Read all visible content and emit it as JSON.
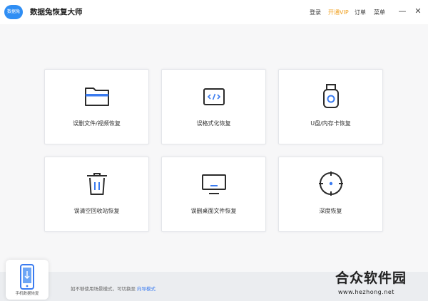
{
  "app": {
    "title": "数据兔恢复大师",
    "logo_text": "数据兔"
  },
  "header": {
    "nav": [
      {
        "id": "login",
        "label": "登录"
      },
      {
        "id": "vip",
        "label": "开通VIP"
      },
      {
        "id": "orders",
        "label": "订单"
      },
      {
        "id": "menu",
        "label": "菜单"
      }
    ],
    "window_controls": {
      "minimize": "—",
      "close": "✕"
    }
  },
  "cards": [
    {
      "label": "误删文件/视频恢复",
      "icon": "folder-icon"
    },
    {
      "label": "误格式化恢复",
      "icon": "code-window-icon"
    },
    {
      "label": "U盘/内存卡恢复",
      "icon": "usb-drive-icon"
    },
    {
      "label": "误清空回收站恢复",
      "icon": "trash-icon"
    },
    {
      "label": "误删桌面文件恢复",
      "icon": "monitor-icon"
    },
    {
      "label": "深度恢复",
      "icon": "crosshair-icon"
    }
  ],
  "footer": {
    "mobile_label": "手机数据恢复",
    "hint": "如不够使用场景模式，可切换至",
    "link": "向导模式"
  },
  "watermark": {
    "cn": "合众软件园",
    "url": "www.hezhong.net"
  },
  "colors": {
    "accent": "#3a7bf0",
    "vip": "#f0a020",
    "icon_stroke": "#2b2b2b"
  }
}
